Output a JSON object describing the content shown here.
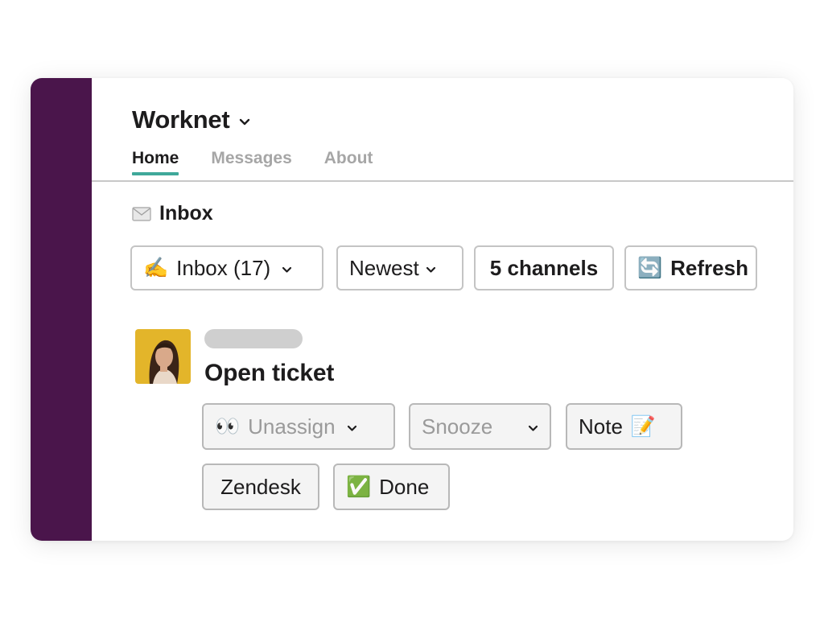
{
  "app": {
    "workspace_name": "Worknet",
    "brand_color": "#4a154b",
    "accent_color": "#3fa89a"
  },
  "tabs": [
    {
      "label": "Home",
      "active": true
    },
    {
      "label": "Messages",
      "active": false
    },
    {
      "label": "About",
      "active": false
    }
  ],
  "section": {
    "icon": "envelope-icon",
    "title": "Inbox"
  },
  "filters": {
    "inbox": {
      "emoji": "✍️",
      "label": "Inbox (17)",
      "icon": "writing-hand-icon"
    },
    "sort": {
      "label": "Newest"
    },
    "channels": {
      "label": "5 channels"
    },
    "refresh": {
      "emoji": "🔄",
      "label": "Refresh",
      "icon": "refresh-icon"
    }
  },
  "ticket": {
    "title": "Open ticket",
    "actions": {
      "unassign": {
        "emoji": "👀",
        "label": "Unassign",
        "icon": "eyes-icon"
      },
      "snooze": {
        "label": "Snooze"
      },
      "note": {
        "label": "Note",
        "emoji": "📝",
        "icon": "memo-icon"
      },
      "zendesk": {
        "label": "Zendesk"
      },
      "done": {
        "emoji": "✅",
        "label": "Done",
        "icon": "check-mark-icon"
      }
    }
  }
}
